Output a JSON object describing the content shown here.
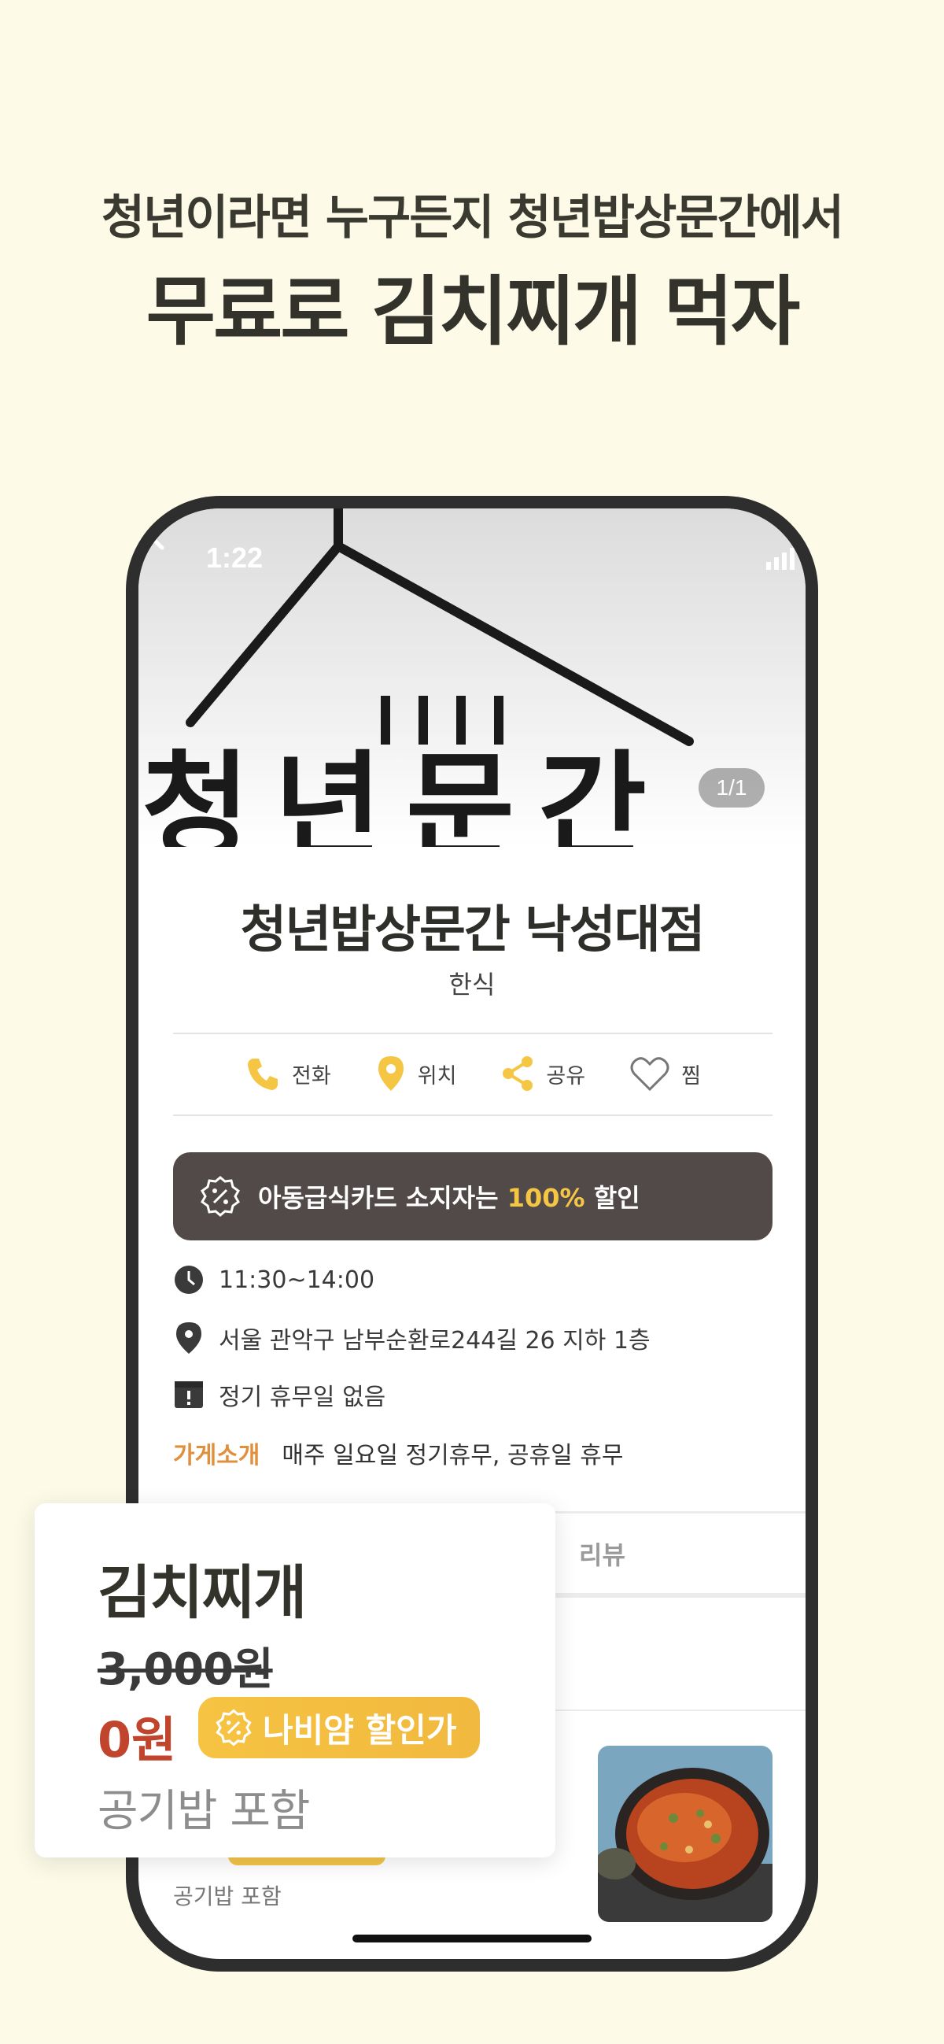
{
  "promo": {
    "line1": "청년이라면 누구든지 청년밥상문간에서",
    "line2": "무료로 김치찌개 먹자"
  },
  "status_bar": {
    "time": "1:22"
  },
  "hero": {
    "page_indicator": "1/1",
    "sign_text": "청년문간"
  },
  "store": {
    "name": "청년밥상문간 낙성대점",
    "category": "한식"
  },
  "actions": [
    {
      "label": "전화",
      "icon": "phone-icon"
    },
    {
      "label": "위치",
      "icon": "location-pin-icon"
    },
    {
      "label": "공유",
      "icon": "share-icon"
    },
    {
      "label": "찜",
      "icon": "heart-icon"
    }
  ],
  "discount_banner": {
    "prefix": "아동급식카드 소지자는 ",
    "highlight": "100%",
    "suffix": " 할인"
  },
  "info": {
    "hours": "11:30~14:00",
    "address": "서울 관악구 남부순환로244길 26 지하 1층",
    "holiday": "정기 휴무일 없음"
  },
  "intro": {
    "label": "가게소개",
    "text": "매주 일요일 정기휴무, 공휴일 휴무"
  },
  "tabs": {
    "review": "리뷰"
  },
  "menu_list": {
    "rice_note": "공기밥 포함"
  },
  "menu_card": {
    "name": "김치찌개",
    "original_price": "3,000원",
    "price": "0원",
    "badge": "나비얌 할인가",
    "note": "공기밥 포함"
  },
  "colors": {
    "background": "#fdfbe8",
    "accent": "#f5c544",
    "price": "#c0452c",
    "banner": "#524949"
  }
}
